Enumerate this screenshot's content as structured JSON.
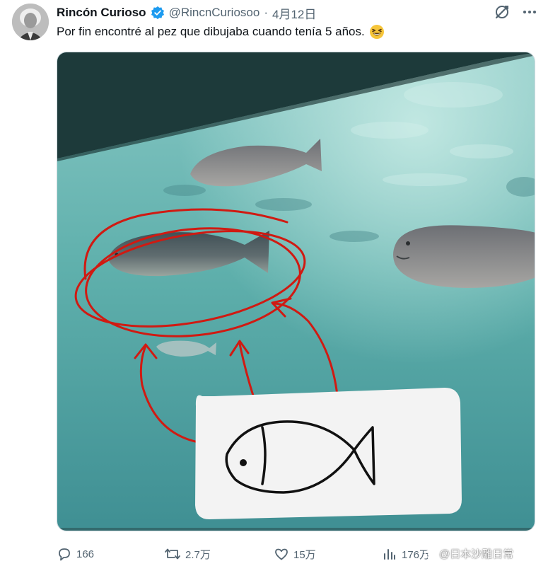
{
  "post": {
    "display_name": "Rincón Curioso",
    "handle": "@RincnCuriosoo",
    "separator": "·",
    "date": "4月12日",
    "text": "Por fin encontré al pez que dibujaba cuando tenía 5 años."
  },
  "icons": {
    "verified": "verified-badge-icon",
    "grok": "grok-icon",
    "more": "more-icon",
    "emoji": "grinning-squinting-face-emoji",
    "reply": "reply-icon",
    "repost": "repost-icon",
    "like": "like-icon",
    "views": "views-icon"
  },
  "stats": {
    "replies": "166",
    "reposts": "2.7万",
    "likes": "15万",
    "views": "176万"
  },
  "watermark": {
    "text": "@日本沙雕日常"
  },
  "colors": {
    "verified_blue": "#1d9bf0",
    "muted_text": "#536471",
    "water": "#5eaaa7",
    "annotation_red": "#d01a12"
  }
}
